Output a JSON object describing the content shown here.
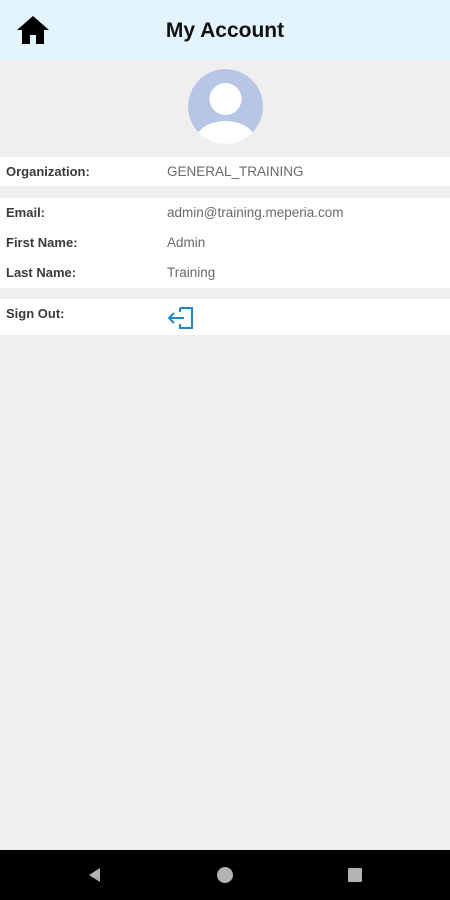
{
  "header": {
    "title": "My Account",
    "icon": "home-icon"
  },
  "profile": {
    "avatar_icon": "user-avatar-icon",
    "avatar_colors": {
      "background": "#b8c6e6",
      "figure": "#ffffff"
    }
  },
  "organization": {
    "label": "Organization:",
    "value": "GENERAL_TRAINING"
  },
  "user": {
    "email_label": "Email:",
    "email_value": "admin@training.meperia.com",
    "first_name_label": "First Name:",
    "first_name_value": "Admin",
    "last_name_label": "Last Name:",
    "last_name_value": "Training"
  },
  "signout": {
    "label": "Sign Out:",
    "icon": "sign-out-icon",
    "icon_color": "#1e88c9"
  },
  "navbar": {
    "back_icon": "back-triangle-icon",
    "home_icon": "home-circle-icon",
    "recents_icon": "recents-square-icon"
  },
  "colors": {
    "header_bg": "#e3f4fd",
    "page_bg": "#efefef"
  }
}
